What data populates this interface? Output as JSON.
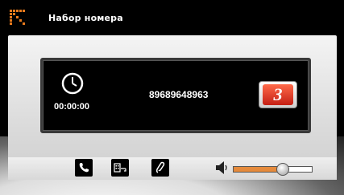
{
  "header": {
    "title": "Набор номера"
  },
  "call": {
    "timer": "00:00:00",
    "number": "89689648963",
    "badge": "3"
  },
  "controls": {
    "buttons": [
      "handset-icon",
      "dialpad-icon",
      "phone-icon"
    ],
    "volume": {
      "level_fraction": 0.62
    }
  },
  "colors": {
    "accent": "#e87a1c",
    "badge_red": "#d3291c",
    "volume_fill": "#e58a3c"
  }
}
